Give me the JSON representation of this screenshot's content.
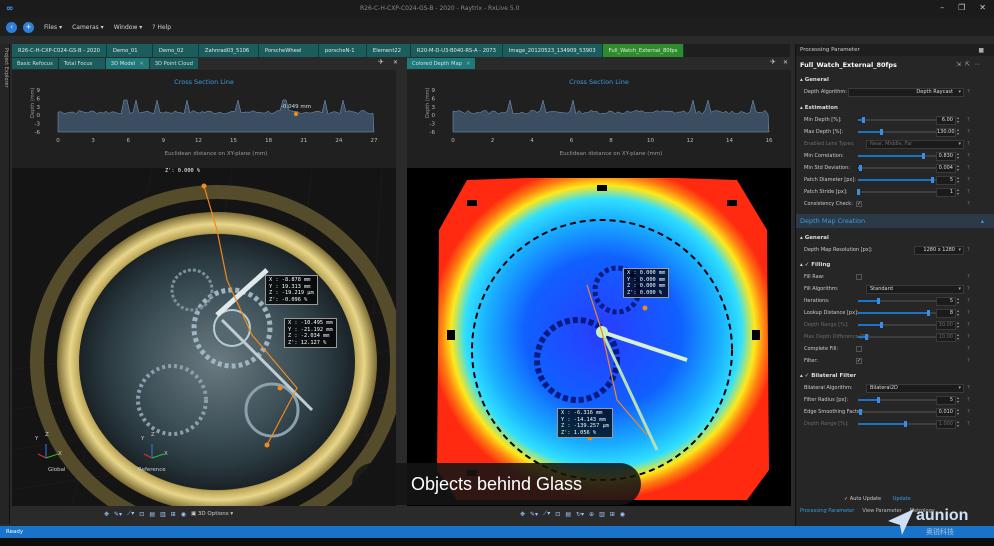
{
  "window": {
    "title": "R26-C-H-CXP-C024-GS-B - 2020 - Raytrix - RxLive 5.0"
  },
  "menu": {
    "items": [
      "Files",
      "Cameras",
      "Window",
      "Help"
    ]
  },
  "project_explorer": {
    "label": "Project Explorer"
  },
  "project_tabs": [
    "R26-C-H-CXP-C024-GS-B - 2020",
    "Demo_01",
    "Demo_02",
    "Zahnrad03_5106",
    "PorscheWheel",
    "porscheN-1",
    "Element22",
    "R20-M-D-U3-B040-RS-A - 2073",
    "Image_20120523_134909_53903",
    "Full_Watch_External_80fps"
  ],
  "left_view": {
    "tabs": [
      "Basic Refocus",
      "Total Focus",
      "3D Model",
      "3D Point Cloud"
    ],
    "active_tab": "3D Model",
    "cross_section": {
      "title": "Cross Section Line",
      "ylabel": "Depth (mm)",
      "xlabel": "Euclidean distance on XY-plane (mm)",
      "yticks": [
        "9",
        "6",
        "3",
        "0",
        "-3",
        "-6"
      ],
      "xticks": [
        "0",
        "3",
        "6",
        "9",
        "12",
        "15",
        "18",
        "21",
        "24",
        "27"
      ],
      "annotation": "-0.049 mm"
    },
    "coords_top": "Z : 0.000 mm\nZ': 0.000 %",
    "box1": "X : -8.878 mm\nY : 19.313 mm\nZ : -19.219 µm\nZ': -0.096 %",
    "box2": "X : -10.495 mm\nY : -21.192 mm\nZ : -2.034 mm\nZ': 12.127 %",
    "axis_global": "Global",
    "axis_reference": "Reference",
    "toolbar_3d": "3D Options"
  },
  "right_view": {
    "tabs": [
      "Colored Depth Map"
    ],
    "active_tab": "Colored Depth Map",
    "cross_section": {
      "title": "Cross Section Line",
      "ylabel": "Depth (mm)",
      "xlabel": "Euclidean distance on XY-plane (mm)",
      "yticks": [
        "9",
        "6",
        "3",
        "0",
        "-3",
        "-6"
      ],
      "xticks": [
        "0",
        "2",
        "4",
        "6",
        "8",
        "10",
        "12",
        "14",
        "16"
      ]
    },
    "box1": "X : 0.000 mm\nY : 0.000 mm\nZ : 0.000 mm\nZ': 0.000 %",
    "box2": "X : -6.316 mm\nY : -14.143 mm\nZ : -139.257 µm\nZ': 1.056 %"
  },
  "panel": {
    "header": "Processing Parameter",
    "title": "Full_Watch_External_80fps",
    "general": "General",
    "depth_algorithm_label": "Depth Algorithm:",
    "depth_algorithm_value": "Depth Raycast",
    "estimation": "Estimation",
    "rows": [
      {
        "label": "Min Depth [%]:",
        "value": "6.00",
        "fill": 0.06,
        "disabled": false
      },
      {
        "label": "Max Depth [%]:",
        "value": "130.00",
        "fill": 0.3,
        "disabled": false
      },
      {
        "label": "Enabled Lens Types:",
        "combo": "Near, Middle, Far",
        "disabled": true
      },
      {
        "label": "Min Correlation:",
        "value": "0.830",
        "fill": 0.83,
        "disabled": false
      },
      {
        "label": "Min Std Deviation:",
        "value": "0.004",
        "fill": 0.02,
        "disabled": false
      },
      {
        "label": "Patch Diameter [px]:",
        "value": "5",
        "fill": 0.95,
        "disabled": false
      },
      {
        "label": "Patch Stride [px]:",
        "value": "1",
        "fill": 0.0,
        "disabled": false
      },
      {
        "label": "Consistency Check:",
        "check": "✓",
        "disabled": false
      }
    ],
    "dmc": "Depth Map Creation",
    "general2": "General",
    "resolution_label": "Depth Map Resolution [px]:",
    "resolution_value": "1280 x 1280",
    "filling": "Filling",
    "rows2": [
      {
        "label": "Fill Raw:",
        "check": "",
        "disabled": false
      },
      {
        "label": "Fill Algorithm:",
        "combo": "Standard",
        "disabled": false
      },
      {
        "label": "Iterations:",
        "value": "5",
        "fill": 0.25,
        "disabled": false
      },
      {
        "label": "Lookup Distance [px]:",
        "value": "8",
        "fill": 0.9,
        "disabled": false
      },
      {
        "label": "Depth Range [%]:",
        "value": "30.00",
        "fill": 0.3,
        "disabled": true
      },
      {
        "label": "Max Depth Difference [%]:",
        "value": "10.00",
        "fill": 0.1,
        "disabled": true
      },
      {
        "label": "Complete Fill:",
        "check": "",
        "disabled": false
      },
      {
        "label": "Filter:",
        "check": "✓",
        "disabled": false
      }
    ],
    "bilateral": "Bilateral Filter",
    "bilateral_algo_label": "Bilateral Algorithm:",
    "bilateral_algo_value": "Bilateral2D",
    "rows3": [
      {
        "label": "Filter Radius [px]:",
        "value": "5",
        "fill": 0.25,
        "disabled": false
      },
      {
        "label": "Edge Smoothing Factor:",
        "value": "0.010",
        "fill": 0.02,
        "disabled": false
      },
      {
        "label": "Depth Range [%]:",
        "value": "1.000",
        "fill": 0.6,
        "disabled": true
      }
    ],
    "auto_update": "Auto Update",
    "update": "Update",
    "tabs": [
      "Processing Parameter",
      "View Parameter",
      "Metrology"
    ]
  },
  "status": {
    "text": "Ready"
  },
  "overlay": {
    "text": "Objects behind Glass"
  },
  "watermark": {
    "brand": "aunion",
    "sub": "奥锐科技"
  },
  "colors": {
    "accent": "#1873c9",
    "tab_green": "#2d8d2d",
    "tab_teal": "#1b5c5c",
    "highlight_blue": "#3a9be0"
  }
}
